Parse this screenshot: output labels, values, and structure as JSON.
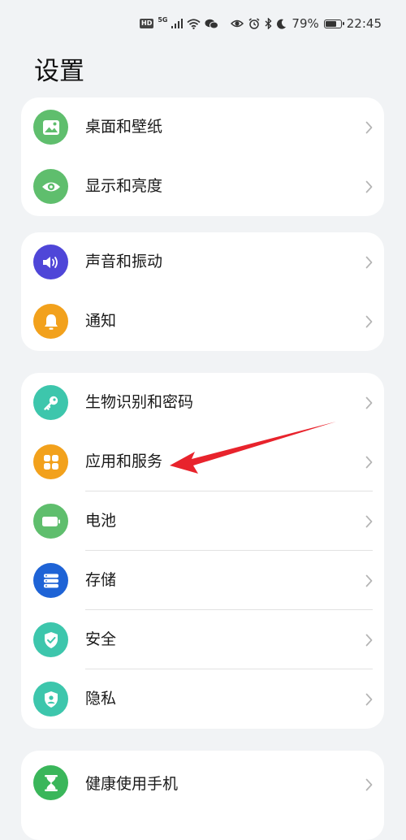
{
  "status_bar": {
    "hd_badge": "HD",
    "network": "5G",
    "battery_text": "79%",
    "battery_level": 0.79,
    "time": "22:45"
  },
  "page": {
    "title": "设置"
  },
  "groups": [
    {
      "items": [
        {
          "label": "桌面和壁纸",
          "icon": "wallpaper-icon",
          "color": "#5fbe6d"
        },
        {
          "label": "显示和亮度",
          "icon": "eye-icon",
          "color": "#5fbe6d"
        }
      ]
    },
    {
      "items": [
        {
          "label": "声音和振动",
          "icon": "speaker-icon",
          "color": "#4f46d8"
        },
        {
          "label": "通知",
          "icon": "bell-icon",
          "color": "#f2a11c"
        }
      ]
    },
    {
      "items": [
        {
          "label": "生物识别和密码",
          "icon": "key-icon",
          "color": "#3dc6ac"
        },
        {
          "label": "应用和服务",
          "icon": "apps-grid-icon",
          "color": "#f2a11c"
        },
        {
          "label": "电池",
          "icon": "battery-icon",
          "color": "#5fbe6d"
        },
        {
          "label": "存储",
          "icon": "storage-icon",
          "color": "#1e63d6"
        },
        {
          "label": "安全",
          "icon": "shield-check-icon",
          "color": "#3dc6ac"
        },
        {
          "label": "隐私",
          "icon": "privacy-icon",
          "color": "#3dc6ac"
        }
      ]
    },
    {
      "items": [
        {
          "label": "健康使用手机",
          "icon": "hourglass-icon",
          "color": "#3ab65a"
        }
      ]
    }
  ],
  "annotation": {
    "color": "#e8232c"
  }
}
